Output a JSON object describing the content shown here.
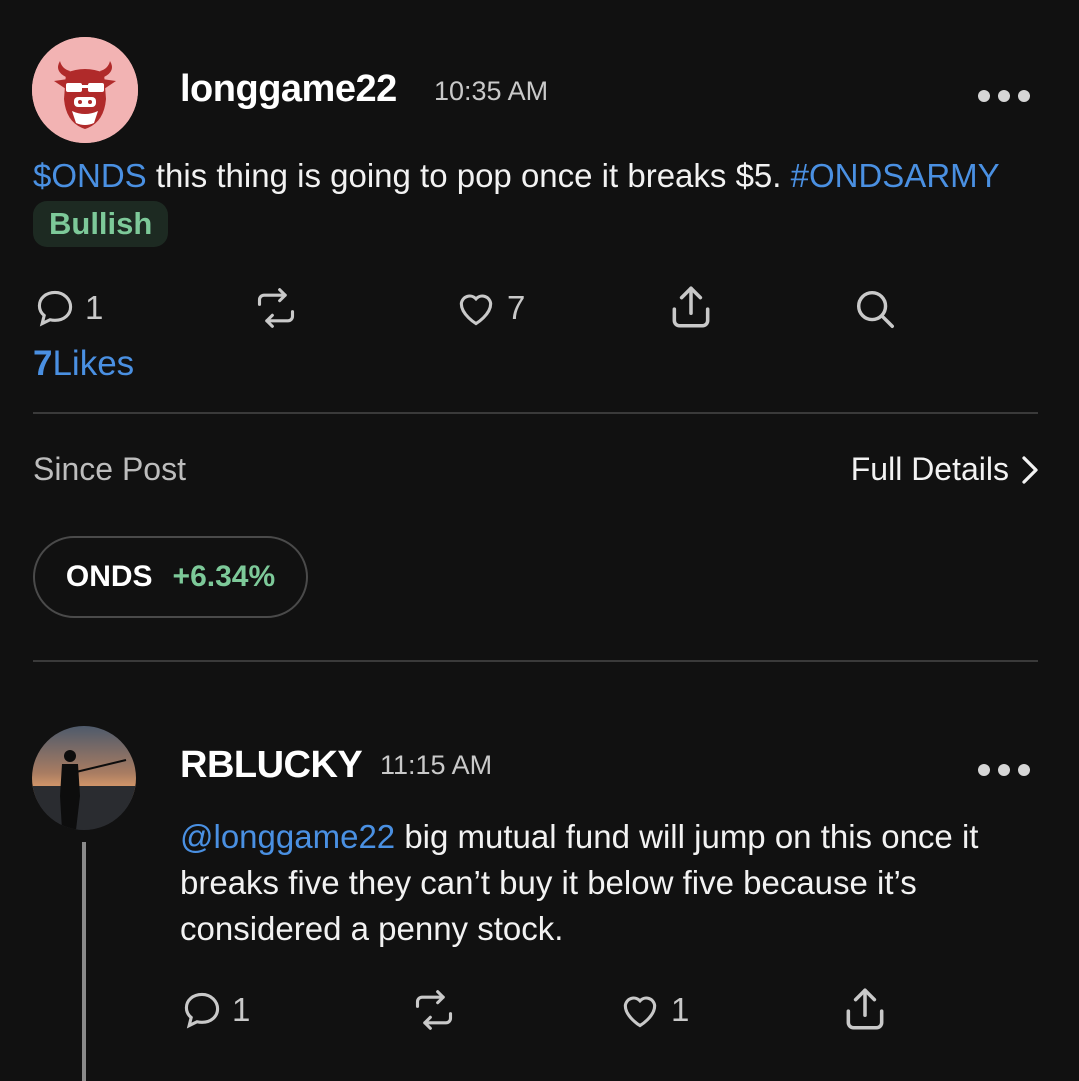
{
  "post": {
    "username": "longgame22",
    "time": "10:35 AM",
    "cashtag": "$ONDS",
    "text": " this thing is going to pop once it breaks $5. ",
    "hashtag": "#ONDSARMY",
    "sentiment": "Bullish",
    "comments": "1",
    "likes": "7",
    "likes_count": "7",
    "likes_label": "Likes"
  },
  "performance": {
    "since_label": "Since Post",
    "details_label": "Full Details",
    "symbol": "ONDS",
    "change": "+6.34%"
  },
  "reply": {
    "username": "RBLUCKY",
    "time": "11:15 AM",
    "mention": "@longgame22",
    "text": " big mutual fund will jump on this once it breaks five they can’t buy it below five because it’s considered a penny stock.",
    "comments": "1",
    "likes": "1"
  },
  "colors": {
    "link": "#4a90e2",
    "positive": "#7dc999",
    "background": "#111111"
  },
  "icons": [
    "bull-avatar-icon",
    "comment-icon",
    "repost-icon",
    "heart-icon",
    "share-icon",
    "search-icon",
    "chevron-right-icon",
    "more-icon"
  ]
}
